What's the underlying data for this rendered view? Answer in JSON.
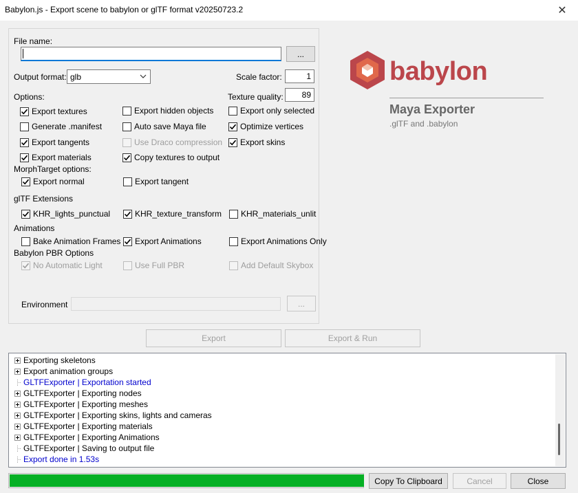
{
  "window": {
    "title": "Babylon.js - Export scene to babylon or glTF format v20250723.2",
    "close_glyph": "✕"
  },
  "file": {
    "label": "File name:",
    "value": "",
    "browse_label": "..."
  },
  "output_format": {
    "label": "Output format:",
    "value": "glb"
  },
  "scale_factor": {
    "label": "Scale factor:",
    "value": "1"
  },
  "options_label": "Options:",
  "texture_quality": {
    "label": "Texture quality:",
    "value": "89"
  },
  "options": {
    "export_textures": {
      "label": "Export textures",
      "checked": true
    },
    "export_hidden_objects": {
      "label": "Export hidden objects",
      "checked": false
    },
    "export_only_selected": {
      "label": "Export only selected",
      "checked": false
    },
    "generate_manifest": {
      "label": "Generate .manifest",
      "checked": false
    },
    "auto_save_maya_file": {
      "label": "Auto save Maya file",
      "checked": false
    },
    "optimize_vertices": {
      "label": "Optimize vertices",
      "checked": true
    },
    "export_tangents": {
      "label": "Export tangents",
      "checked": true
    },
    "use_draco_compression": {
      "label": "Use Draco compression",
      "checked": false,
      "disabled": true
    },
    "export_skins": {
      "label": "Export skins",
      "checked": true
    },
    "export_materials": {
      "label": "Export materials",
      "checked": true
    },
    "copy_textures_to_output": {
      "label": "Copy textures to output",
      "checked": true
    }
  },
  "morph_label": "MorphTarget options:",
  "morph": {
    "export_normal": {
      "label": "Export normal",
      "checked": true
    },
    "export_tangent": {
      "label": "Export tangent",
      "checked": false
    }
  },
  "gltf_ext_label": "glTF Extensions",
  "gltf_ext": {
    "khr_lights_punctual": {
      "label": "KHR_lights_punctual",
      "checked": true
    },
    "khr_texture_transform": {
      "label": "KHR_texture_transform",
      "checked": true
    },
    "khr_materials_unlit": {
      "label": "KHR_materials_unlit",
      "checked": false
    }
  },
  "animations_label": "Animations",
  "animations": {
    "bake_animation_frames": {
      "label": "Bake Animation Frames",
      "checked": false
    },
    "export_animations": {
      "label": "Export Animations",
      "checked": true
    },
    "export_animations_only": {
      "label": "Export Animations Only",
      "checked": false
    }
  },
  "pbr_label": "Babylon PBR Options",
  "pbr": {
    "no_automatic_light": {
      "label": "No Automatic Light",
      "checked": true,
      "disabled": true
    },
    "use_full_pbr": {
      "label": "Use Full PBR",
      "checked": false,
      "disabled": true
    },
    "add_default_skybox": {
      "label": "Add Default Skybox",
      "checked": false,
      "disabled": true
    }
  },
  "environment": {
    "label": "Environment",
    "value": "",
    "browse_label": "..."
  },
  "logo": {
    "wordmark": "babylon",
    "product": "Maya Exporter",
    "subtitle": ".glTF and .babylon",
    "brand_color": "#bb464b"
  },
  "actions": {
    "export_label": "Export",
    "export_run_label": "Export & Run"
  },
  "log": [
    {
      "text": "Exporting skeletons",
      "expandable": true,
      "color": "#000000"
    },
    {
      "text": "Export animation groups",
      "expandable": true,
      "color": "#000000"
    },
    {
      "text": "GLTFExporter | Exportation started",
      "expandable": false,
      "color": "#0000cd"
    },
    {
      "text": "GLTFExporter | Exporting nodes",
      "expandable": true,
      "color": "#000000"
    },
    {
      "text": "GLTFExporter | Exporting meshes",
      "expandable": true,
      "color": "#000000"
    },
    {
      "text": "GLTFExporter | Exporting skins, lights and cameras",
      "expandable": true,
      "color": "#000000"
    },
    {
      "text": "GLTFExporter | Exporting materials",
      "expandable": true,
      "color": "#000000"
    },
    {
      "text": "GLTFExporter | Exporting Animations",
      "expandable": true,
      "color": "#000000"
    },
    {
      "text": "GLTFExporter | Saving to output file",
      "expandable": false,
      "color": "#000000"
    },
    {
      "text": "Export done in 1.53s",
      "expandable": false,
      "color": "#0000cd"
    }
  ],
  "progress": {
    "fraction": 1.0,
    "color": "#06b025"
  },
  "footer": {
    "copy_label": "Copy To Clipboard",
    "cancel_label": "Cancel",
    "close_label": "Close"
  }
}
